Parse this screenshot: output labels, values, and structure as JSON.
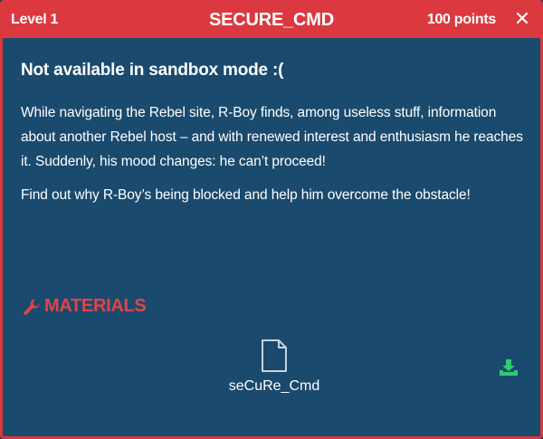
{
  "header": {
    "level": "Level 1",
    "title": "SECURE_CMD",
    "points": "100 points",
    "close_icon": "close-icon"
  },
  "body": {
    "heading": "Not available in sandbox mode :(",
    "paragraphs": [
      "While navigating the Rebel site, R-Boy finds, among useless stuff, information about another Rebel host – and with renewed interest and enthusiasm he reaches it. Suddenly, his mood changes: he can’t proceed!",
      "Find out why R-Boy’s being blocked and help him overcome the obstacle!"
    ]
  },
  "materials": {
    "label": "MATERIALS",
    "icon": "wrench-icon",
    "files": [
      {
        "name": "seCuRe_Cmd",
        "icon": "file-icon",
        "action_icon": "download-icon"
      }
    ]
  },
  "colors": {
    "header_bg": "#db393f",
    "panel_bg": "#1a4a6e",
    "accent_red": "#e04448",
    "download_green": "#2ecc71"
  }
}
